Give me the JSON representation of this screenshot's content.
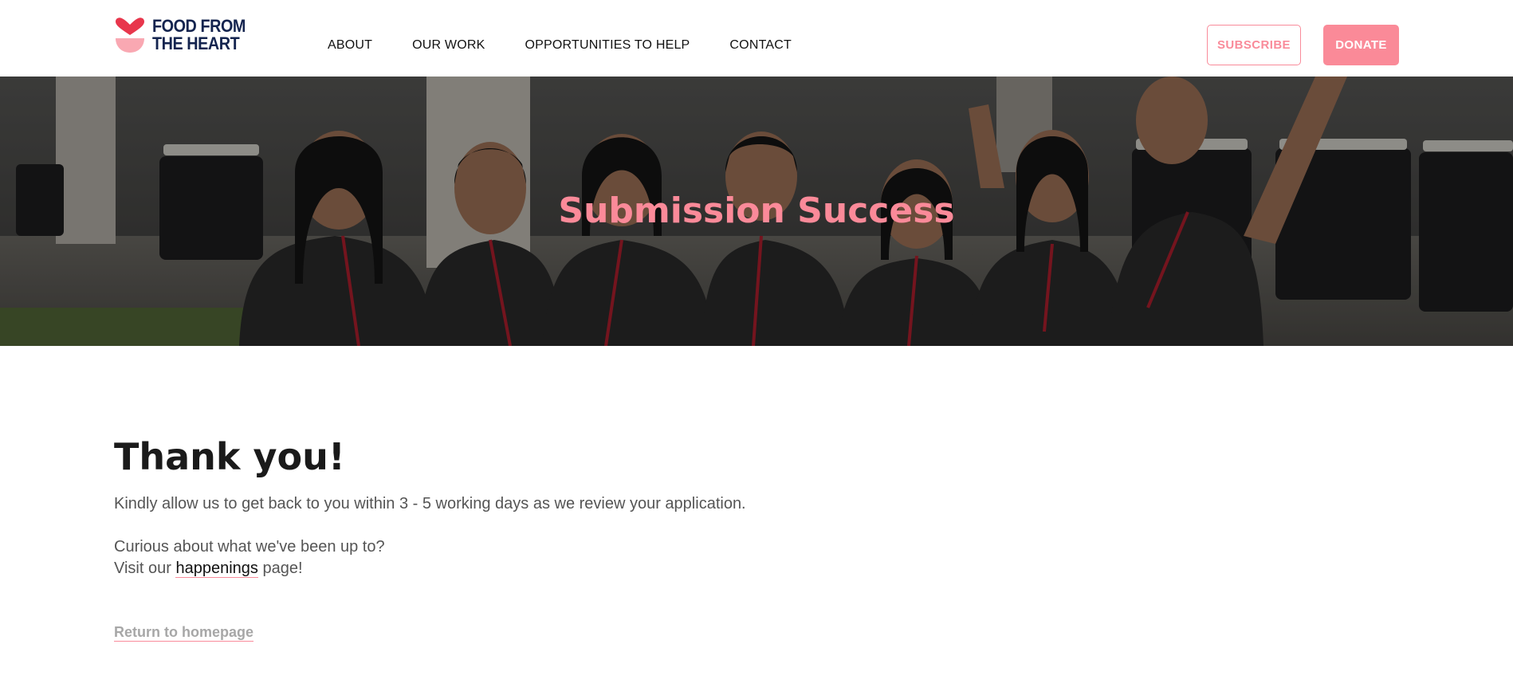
{
  "brand": {
    "logo_line1": "FOOD FROM",
    "logo_line2": "THE HEART",
    "primary_color": "#14244f",
    "accent_color": "#f98b9a"
  },
  "nav": {
    "items": [
      {
        "label": "ABOUT"
      },
      {
        "label": "OUR WORK"
      },
      {
        "label": "OPPORTUNITIES TO HELP"
      },
      {
        "label": "CONTACT"
      }
    ]
  },
  "header_buttons": {
    "subscribe_label": "SUBSCRIBE",
    "donate_label": "DONATE"
  },
  "hero": {
    "title": "Submission Success"
  },
  "main": {
    "heading": "Thank you!",
    "paragraph1": "Kindly allow us to get back to you within 3 - 5 working days as we review your application.",
    "paragraph2_line1": "Curious about what we've been up to?",
    "paragraph2_line2_prefix": "Visit our ",
    "happenings_link": "happenings",
    "paragraph2_line2_suffix": " page!",
    "return_link": "Return to homepage"
  }
}
